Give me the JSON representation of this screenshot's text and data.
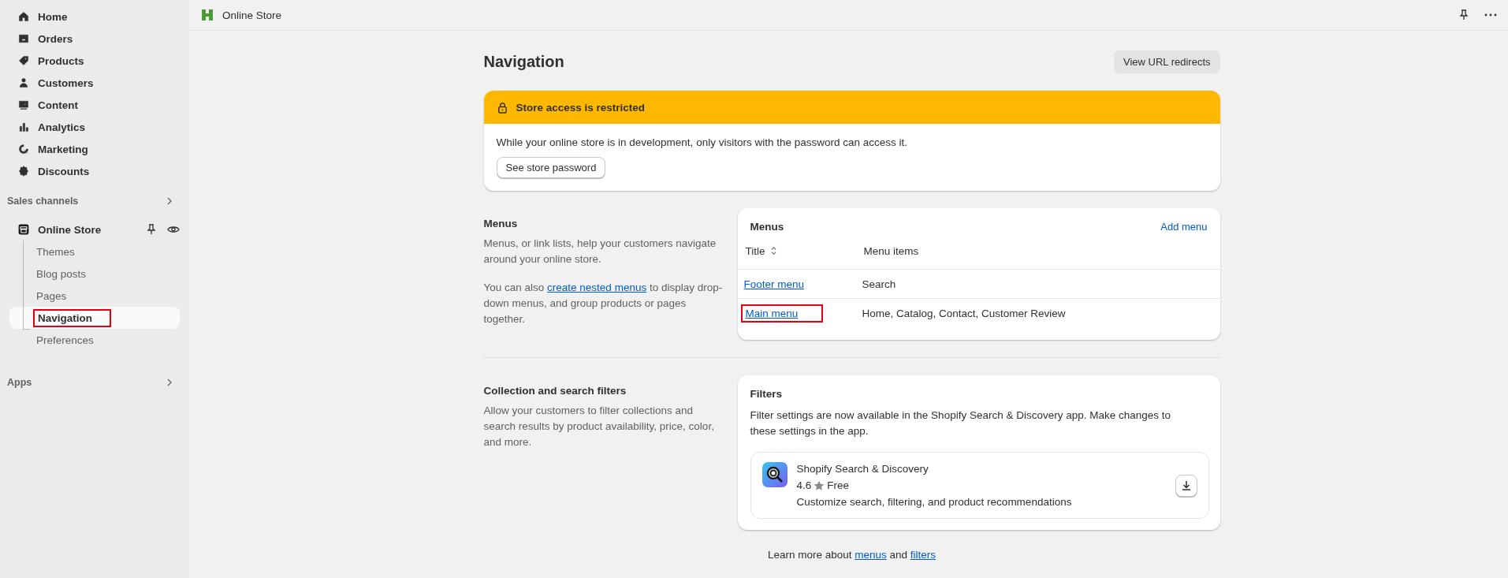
{
  "top_bar": {
    "title": "Online Store"
  },
  "sidebar": {
    "items": [
      {
        "label": "Home"
      },
      {
        "label": "Orders"
      },
      {
        "label": "Products"
      },
      {
        "label": "Customers"
      },
      {
        "label": "Content"
      },
      {
        "label": "Analytics"
      },
      {
        "label": "Marketing"
      },
      {
        "label": "Discounts"
      }
    ],
    "sales_channels": {
      "label": "Sales channels",
      "channel": {
        "label": "Online Store",
        "children": [
          {
            "label": "Themes",
            "selected": false,
            "highlighted": false
          },
          {
            "label": "Blog posts",
            "selected": false,
            "highlighted": false
          },
          {
            "label": "Pages",
            "selected": false,
            "highlighted": false
          },
          {
            "label": "Navigation",
            "selected": true,
            "highlighted": true
          },
          {
            "label": "Preferences",
            "selected": false,
            "highlighted": false
          }
        ]
      }
    },
    "apps": {
      "label": "Apps"
    }
  },
  "page": {
    "title": "Navigation",
    "action": "View URL redirects"
  },
  "banner": {
    "title": "Store access is restricted",
    "text": "While your online store is in development, only visitors with the password can access it.",
    "button": "See store password"
  },
  "menus_section": {
    "heading": "Menus",
    "text": "Menus, or link lists, help your customers navigate around your online store.",
    "text2_before": "You can also",
    "text2_link": "create nested menus",
    "text2_after": "to display drop-down menus, and group products or pages together.",
    "card": {
      "title": "Menus",
      "action": "Add menu",
      "columns": [
        "Title",
        "Menu items"
      ],
      "rows": [
        {
          "title": "Footer menu",
          "items": "Search",
          "highlighted": false
        },
        {
          "title": "Main menu",
          "items": "Home, Catalog, Contact, Customer Review",
          "highlighted": true
        }
      ]
    }
  },
  "filters_section": {
    "heading": "Collection and search filters",
    "text": "Allow your customers to filter collections and search results by product availability, price, color, and more.",
    "card": {
      "title": "Filters",
      "text": "Filter settings are now available in the Shopify Search & Discovery app. Make changes to these settings in the app.",
      "app": {
        "name": "Shopify Search & Discovery",
        "rating": "4.6",
        "price": "Free",
        "description": "Customize search, filtering, and product recommendations"
      }
    }
  },
  "footer": {
    "before": "Learn more about",
    "link1": "menus",
    "middle": "and",
    "link2": "filters"
  }
}
